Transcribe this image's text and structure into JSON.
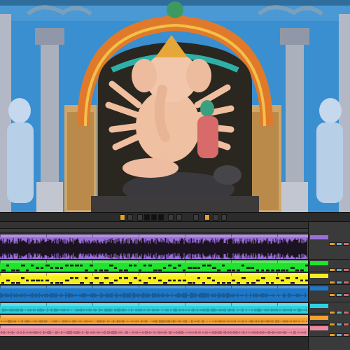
{
  "colors": {
    "temple_sky": "#3a8fd0",
    "accent_orange": "#e8a020",
    "track_purple": "#9a6ed8",
    "track_green": "#1fe32d",
    "track_yellow": "#f5ee1f",
    "track_blue": "#1d78c8",
    "track_cyan": "#2ed0e0",
    "track_orange": "#f5a030",
    "track_pink": "#ee8aa0"
  },
  "viewer": {
    "subject_icon": "ganesha-statue-image"
  },
  "tracks": [
    {
      "color": "#9a6ed8",
      "clips": [
        {
          "w": 66,
          "label": ""
        },
        {
          "w": 66,
          "label": ""
        },
        {
          "w": 66,
          "label": ""
        },
        {
          "w": 66,
          "label": ""
        },
        {
          "w": 66,
          "label": ""
        },
        {
          "w": 66,
          "label": ""
        },
        {
          "w": 44,
          "label": ""
        }
      ],
      "kind": "dense"
    },
    {
      "color": "#1fe32d",
      "clips": [
        {
          "w": 66,
          "label": ""
        },
        {
          "w": 66,
          "label": ""
        },
        {
          "w": 66,
          "label": ""
        },
        {
          "w": 66,
          "label": ""
        },
        {
          "w": 66,
          "label": ""
        },
        {
          "w": 66,
          "label": ""
        },
        {
          "w": 44,
          "label": ""
        }
      ],
      "kind": "midi"
    },
    {
      "color": "#f5ee1f",
      "clips": [
        {
          "w": 66,
          "label": ""
        },
        {
          "w": 66,
          "label": ""
        },
        {
          "w": 66,
          "label": ""
        },
        {
          "w": 66,
          "label": ""
        },
        {
          "w": 66,
          "label": ""
        },
        {
          "w": 66,
          "label": ""
        },
        {
          "w": 44,
          "label": ""
        }
      ],
      "kind": "midi"
    },
    {
      "color": "#1d78c8",
      "clips": [
        {
          "w": 66,
          "label": ""
        },
        {
          "w": 66,
          "label": ""
        },
        {
          "w": 66,
          "label": ""
        },
        {
          "w": 66,
          "label": ""
        },
        {
          "w": 66,
          "label": ""
        },
        {
          "w": 66,
          "label": ""
        },
        {
          "w": 44,
          "label": ""
        }
      ],
      "kind": "sparse"
    },
    {
      "color": "#2ed0e0",
      "clips": [
        {
          "w": 66,
          "label": ""
        },
        {
          "w": 66,
          "label": ""
        },
        {
          "w": 66,
          "label": ""
        },
        {
          "w": 66,
          "label": ""
        },
        {
          "w": 66,
          "label": ""
        },
        {
          "w": 66,
          "label": ""
        },
        {
          "w": 44,
          "label": ""
        }
      ],
      "kind": "sparse"
    },
    {
      "color": "#f5a030",
      "clips": [
        {
          "w": 440,
          "label": ""
        }
      ],
      "kind": "sparse"
    },
    {
      "color": "#ee8aa0",
      "clips": [
        {
          "w": 440,
          "label": ""
        }
      ],
      "kind": "sparse"
    }
  ]
}
